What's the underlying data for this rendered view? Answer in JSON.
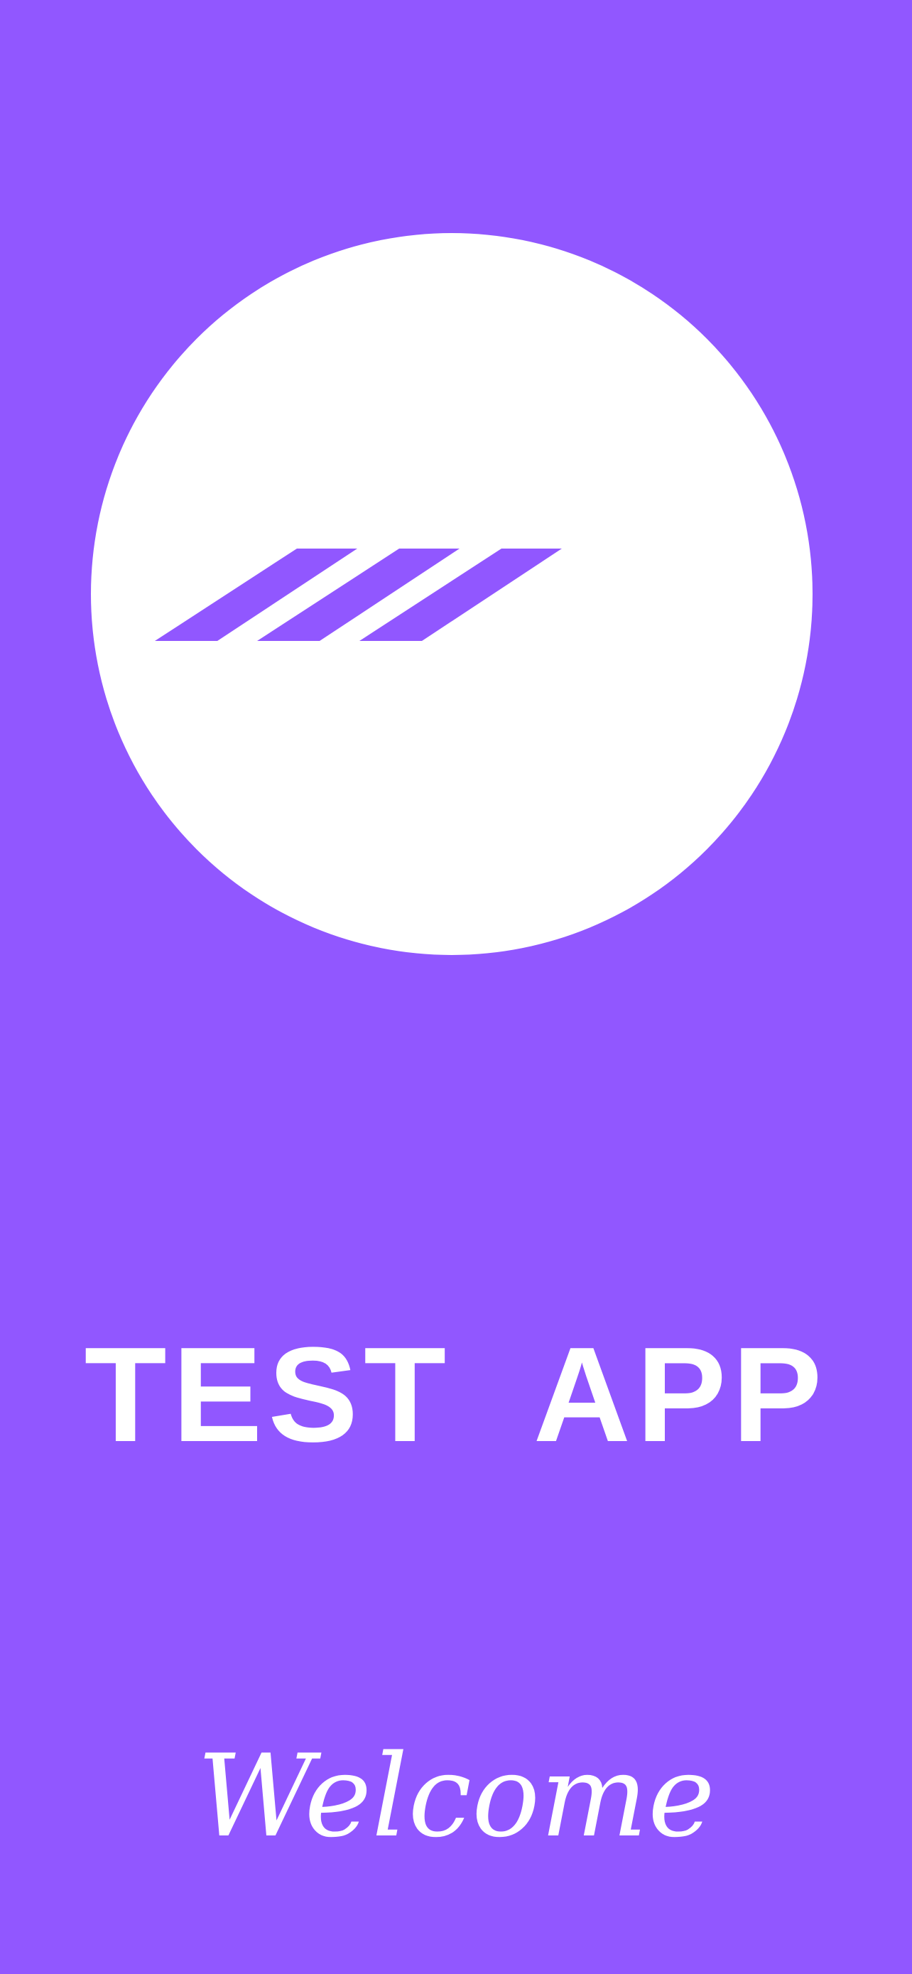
{
  "app": {
    "title": "TEST  APP",
    "welcome_text": "Welcome"
  },
  "logo": {
    "icon": "three-slanted-stripes-icon"
  },
  "colors": {
    "background": "#9157FF",
    "logo_circle": "#FFFFFF",
    "logo_stripes": "#9157FF",
    "text": "#FFFFFF"
  }
}
